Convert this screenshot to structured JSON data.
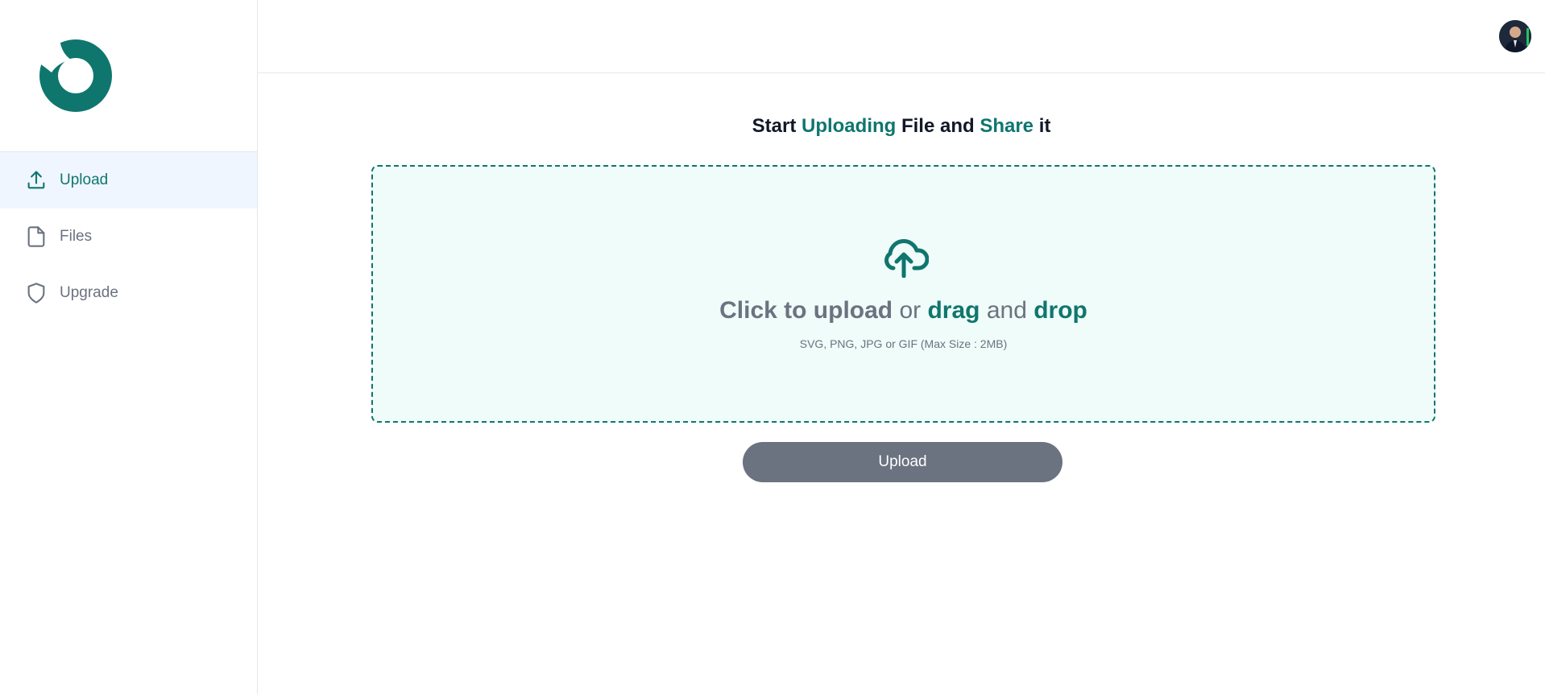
{
  "sidebar": {
    "items": [
      {
        "label": "Upload",
        "icon": "upload-icon",
        "active": true
      },
      {
        "label": "Files",
        "icon": "file-icon",
        "active": false
      },
      {
        "label": "Upgrade",
        "icon": "shield-icon",
        "active": false
      }
    ]
  },
  "main": {
    "headline": {
      "p1": "Start ",
      "p2": "Uploading",
      "p3": " File and ",
      "p4": "Share",
      "p5": " it"
    },
    "dropzone": {
      "icon": "cloud-upload-icon",
      "click": "Click to upload",
      "or": " or ",
      "drag": "drag",
      "and": " and ",
      "drop": "drop",
      "hint": "SVG, PNG, JPG or GIF (Max Size : 2MB)"
    },
    "upload_button": "Upload"
  },
  "colors": {
    "accent": "#0f766e",
    "dropzone_bg": "#effcf9",
    "button_bg": "#6b7280",
    "active_nav_bg": "#eff6ff"
  }
}
